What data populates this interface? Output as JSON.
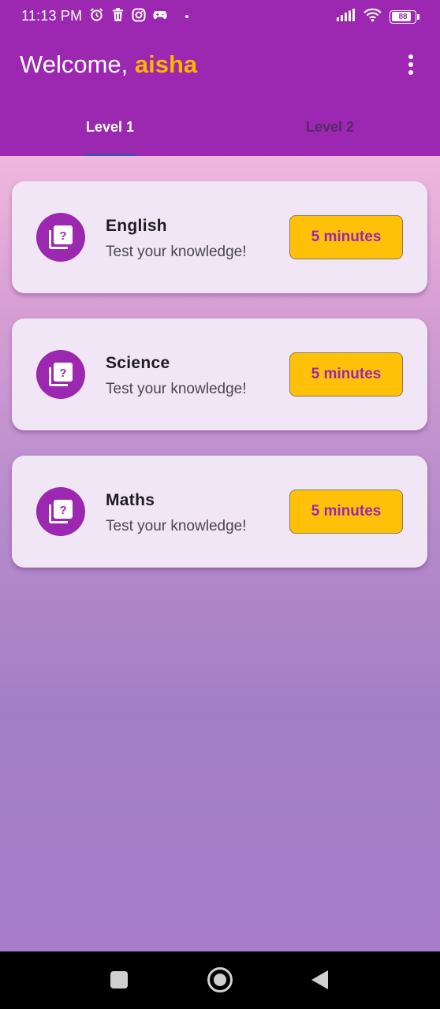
{
  "status_bar": {
    "time": "11:13 PM",
    "left_icons": [
      "alarm-icon",
      "trash-icon",
      "instagram-icon",
      "gamepad-icon",
      "dot-icon"
    ],
    "right_icons": [
      "signal-icon",
      "wifi-icon",
      "battery-icon"
    ],
    "battery_level": "88"
  },
  "app_bar": {
    "greeting": "Welcome,",
    "username": "aisha",
    "menu_icon": "more-vert-icon"
  },
  "tabs": [
    {
      "label": "Level 1",
      "selected": true
    },
    {
      "label": "Level 2",
      "selected": false
    }
  ],
  "quizzes": [
    {
      "title": "English",
      "subtitle": "Test your knowledge!",
      "duration": "5 minutes",
      "icon": "quiz-icon"
    },
    {
      "title": "Science",
      "subtitle": "Test your knowledge!",
      "duration": "5 minutes",
      "icon": "quiz-icon"
    },
    {
      "title": "Maths",
      "subtitle": "Test your knowledge!",
      "duration": "5 minutes",
      "icon": "quiz-icon"
    }
  ],
  "nav_bar": {
    "buttons": [
      "recents-icon",
      "home-icon",
      "back-icon"
    ]
  },
  "colors": {
    "primary": "#9c27b0",
    "accent": "#ffc107",
    "username": "#ffb300",
    "card_bg": "#f0e6f5",
    "tab_indicator": "#3f51b5"
  }
}
